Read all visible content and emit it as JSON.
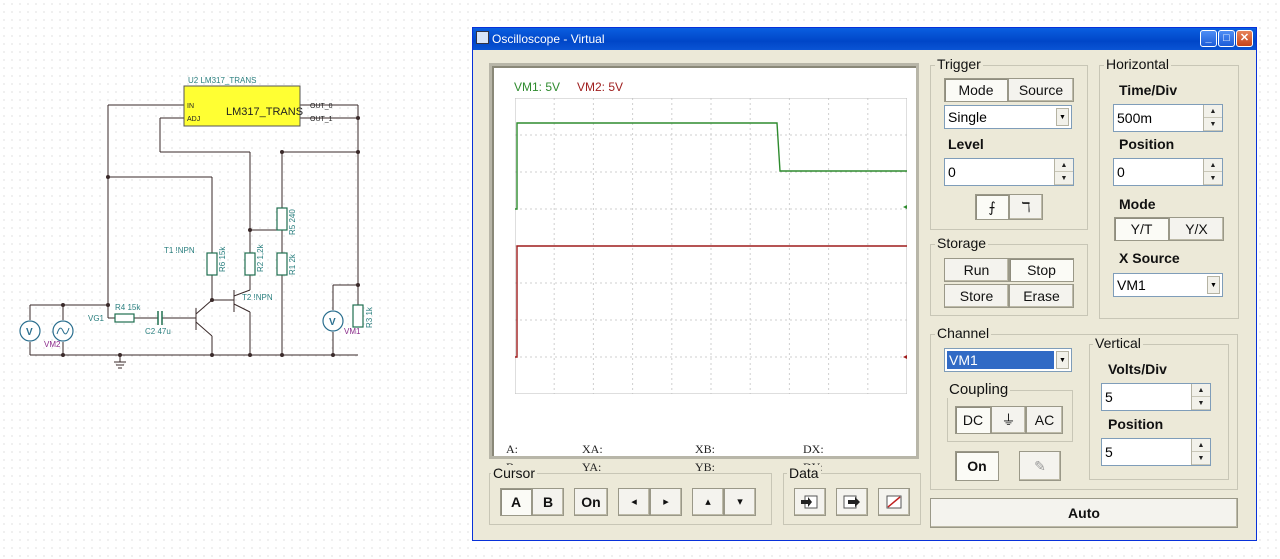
{
  "schematic": {
    "component_label": "U2 LM317_TRANS",
    "component_name": "LM317_TRANS",
    "pin_in": "IN",
    "pin_adj": "ADJ",
    "pin_out0": "OUT_0",
    "pin_out1": "OUT_1",
    "t1": "T1 !NPN",
    "t2": "T2 !NPN",
    "r6": "R6 15k",
    "r2": "R2 1,2k",
    "r5": "R5 240",
    "r1": "R1 2k",
    "r4": "R4 15k",
    "r3": "R3 1k",
    "c2": "C2 47u",
    "vg1": "VG1",
    "vm2": "VM2",
    "vm1": "VM1",
    "meter_symbol": "V"
  },
  "window": {
    "title": "Oscilloscope - Virtual",
    "minimize": "_",
    "maximize": "□",
    "close": "✕"
  },
  "scope": {
    "ch1_label": "VM1: 5V",
    "ch2_label": "VM2: 5V",
    "ch1_color": "#2e8b2e",
    "ch2_color": "#9e1c1c",
    "measure": {
      "a": "A:",
      "b": "B:",
      "xa": "XA:",
      "ya": "YA:",
      "xb": "XB:",
      "yb": "YB:",
      "dx": "DX:",
      "dy": "DY:"
    }
  },
  "trigger": {
    "title": "Trigger",
    "mode_btn": "Mode",
    "source_btn": "Source",
    "mode_value": "Single",
    "level_label": "Level",
    "level_value": "0",
    "rising_icon": "⨍",
    "falling_icon": "ℸ"
  },
  "horizontal": {
    "title": "Horizontal",
    "timediv_label": "Time/Div",
    "timediv_value": "500m",
    "position_label": "Position",
    "position_value": "0",
    "mode_label": "Mode",
    "yt": "Y/T",
    "yx": "Y/X",
    "xsource_label": "X Source",
    "xsource_value": "VM1"
  },
  "storage": {
    "title": "Storage",
    "run": "Run",
    "stop": "Stop",
    "store": "Store",
    "erase": "Erase"
  },
  "channel": {
    "title": "Channel",
    "value": "VM1",
    "coupling_label": "Coupling",
    "dc": "DC",
    "gnd": "⏚",
    "ac": "AC",
    "on": "On",
    "pen_icon": "✎"
  },
  "vertical": {
    "title": "Vertical",
    "voltsdiv_label": "Volts/Div",
    "voltsdiv_value": "5",
    "position_label": "Position",
    "position_value": "5"
  },
  "cursor": {
    "title": "Cursor",
    "a": "A",
    "b": "B",
    "on": "On",
    "left": "◂",
    "right": "▸",
    "up": "▴",
    "down": "▾"
  },
  "data_group": {
    "title": "Data"
  },
  "auto": "Auto",
  "spin_up": "▲",
  "spin_down": "▼",
  "dd_arrow": "▼"
}
